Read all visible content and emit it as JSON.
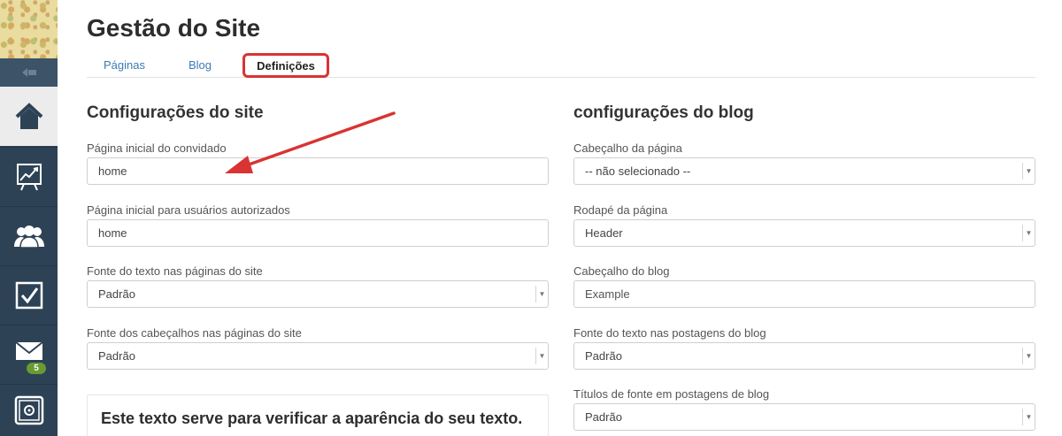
{
  "sidebar": {
    "items": [
      {
        "icon": "home-icon",
        "active": true
      },
      {
        "icon": "chart-icon",
        "active": false
      },
      {
        "icon": "users-icon",
        "active": false
      },
      {
        "icon": "checkbox-icon",
        "active": false
      },
      {
        "icon": "mail-icon",
        "active": false,
        "badge": "5"
      },
      {
        "icon": "settings-icon",
        "active": false
      }
    ]
  },
  "header": {
    "title": "Gestão do Site",
    "tabs": [
      {
        "label": "Páginas"
      },
      {
        "label": "Blog"
      },
      {
        "label": "Definições",
        "active": true
      }
    ],
    "accent_color": "#d93333"
  },
  "site_config": {
    "title": "Configurações do site",
    "guest_home": {
      "label": "Página inicial do convidado",
      "value": "home"
    },
    "auth_home": {
      "label": "Página inicial para usuários autorizados",
      "value": "home"
    },
    "text_font": {
      "label": "Fonte do texto nas páginas do site",
      "value": "Padrão"
    },
    "heading_font": {
      "label": "Fonte dos cabeçalhos nas páginas do site",
      "value": "Padrão"
    },
    "preview_text": "Este texto serve para verificar a aparência do seu texto."
  },
  "blog_config": {
    "title": "configurações do blog",
    "page_header": {
      "label": "Cabeçalho da página",
      "value": "-- não selecionado --"
    },
    "page_footer": {
      "label": "Rodapé da página",
      "value": "Header"
    },
    "blog_header": {
      "label": "Cabeçalho do blog",
      "placeholder": "Example"
    },
    "post_text_font": {
      "label": "Fonte do texto nas postagens do blog",
      "value": "Padrão"
    },
    "post_heading_font": {
      "label": "Títulos de fonte em postagens de blog",
      "value": "Padrão"
    }
  }
}
